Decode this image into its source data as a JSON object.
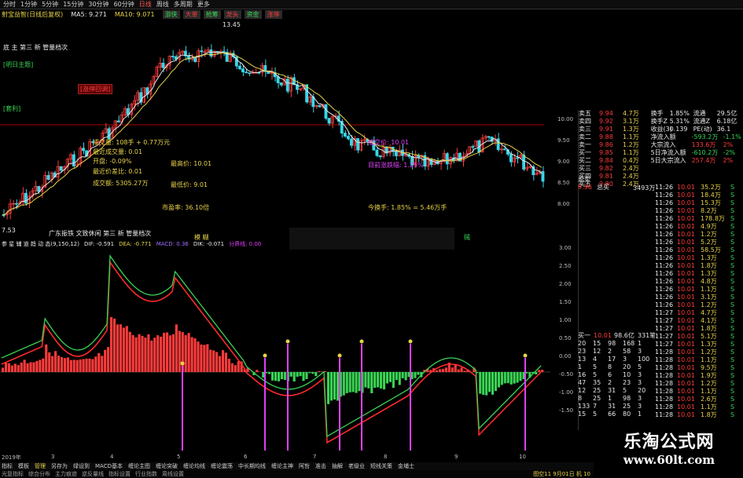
{
  "topbar": {
    "items": [
      "分时",
      "1分钟",
      "5分钟",
      "15分钟",
      "30分钟",
      "60分钟",
      "日线",
      "周线",
      "多周期",
      "更多"
    ],
    "selected": "日线"
  },
  "infobar": {
    "title": "射宝益智(日线后复权)",
    "ma_label": "MA5: 9.271",
    "ma10_label": "MA10: 9.071",
    "chips": [
      "游侠",
      "大单",
      "抢筹",
      "龙头",
      "资金",
      "涨停"
    ]
  },
  "main_chart": {
    "price_high_label": "13.45",
    "price_low_label": "7.53",
    "top_left_text": "底 主  第三 新 管量档次",
    "indicator_tag_1": "[明日主题]",
    "indicator_tag_2": "[套利]",
    "indicator_tag_3": "[涨停回调]",
    "box_labels": [
      "成交量: 108手 + 0.77万元",
      "最近成交量: 0.01",
      "开盘: -0.09%",
      "最近价差比: 0.01",
      "成交额: 5305.27万",
      "最高价: 10.01",
      "最低价: 9.01",
      "市盈率: 36.10倍"
    ],
    "mid_labels": [
      "成交价: 10.01",
      "目前涨跌幅: 1.25%"
    ],
    "right_label": "今换手: 1.85% = 5.46万手",
    "bottom_text": "广东振铁 文致休闲 第三 新 管量档次",
    "legend_center": "模 糊",
    "legend_right": "贼",
    "yticks": [
      "10.00",
      "9.50",
      "9.00",
      "8.50",
      "8.00"
    ]
  },
  "indicator": {
    "header": "参 星 辅 道 趋 动 态(9,150,12)",
    "dif": "DIF: -0.591",
    "dea": "DEA: -0.771",
    "macd": "MACD: 0.36",
    "dif2": "DIK: -0.071",
    "extra": "分界线: 0.00",
    "yticks": [
      "3.00",
      "2.50",
      "2.00",
      "1.50",
      "1.00",
      "0.50",
      "0.00",
      "-0.50",
      "-1.00",
      "-1.50"
    ],
    "xticks": [
      "2019年",
      "3",
      "4",
      "5",
      "6",
      "7",
      "8",
      "9",
      "10"
    ]
  },
  "right_panel": {
    "sell_rows": [
      {
        "label": "卖五",
        "price": "9.94",
        "vol": "4.7万"
      },
      {
        "label": "卖四",
        "price": "9.92",
        "vol": "3.1万"
      },
      {
        "label": "卖三",
        "price": "9.91",
        "vol": "1.3万"
      },
      {
        "label": "卖二",
        "price": "9.88",
        "vol": "1.1万"
      },
      {
        "label": "卖一",
        "price": "9.86",
        "vol": "1.2万"
      },
      {
        "label": "买一",
        "price": "9.85",
        "vol": "1.1万"
      },
      {
        "label": "买二",
        "price": "9.84",
        "vol": "0.4万"
      },
      {
        "label": "买三",
        "price": "9.82",
        "vol": "2.4万"
      },
      {
        "label": "买四",
        "price": "9.81",
        "vol": "2.4万"
      },
      {
        "label": "买五",
        "price": "9.80",
        "vol": "2.4万"
      }
    ],
    "summary_rows": [
      {
        "a": "换手",
        "b": "1.85%",
        "c": "流通",
        "d": "29.5亿"
      },
      {
        "a": "换手Z",
        "b": "5.31%",
        "c": "流通Z",
        "d": "6.18亿"
      },
      {
        "a": "收益(3)",
        "b": "0.139",
        "c": "PE(动)",
        "d": "36.1"
      }
    ],
    "flow_rows": [
      {
        "label": "净流入额",
        "value": "-593.2万",
        "pct": "-1.1%"
      },
      {
        "label": "大宗流入",
        "value": "133.6万",
        "pct": "2%"
      },
      {
        "label": "5日净流入额",
        "value": "-610.2万",
        "pct": "-2%"
      },
      {
        "label": "5日大宗流入",
        "value": "257.4万",
        "pct": "2%"
      }
    ],
    "totals": {
      "t1": "总卖",
      "t2": "总买",
      "v": "3493万"
    },
    "ticks": [
      {
        "time": "11:26",
        "price": "10.01",
        "vol": "35.2万",
        "side": "S"
      },
      {
        "time": "11:26",
        "price": "10.01",
        "vol": "18.4万",
        "side": "S"
      },
      {
        "time": "11:26",
        "price": "10.01",
        "vol": "15.3万",
        "side": "S"
      },
      {
        "time": "11:26",
        "price": "10.01",
        "vol": "8.2万",
        "side": "S"
      },
      {
        "time": "11:26",
        "price": "10.01",
        "vol": "178.8万",
        "side": "S"
      },
      {
        "time": "11:26",
        "price": "10.01",
        "vol": "4.9万",
        "side": "S"
      },
      {
        "time": "11:26",
        "price": "10.01",
        "vol": "1.2万",
        "side": "S"
      },
      {
        "time": "11:26",
        "price": "10.01",
        "vol": "5.2万",
        "side": "S"
      },
      {
        "time": "11:26",
        "price": "10.01",
        "vol": "58.5万",
        "side": "S"
      },
      {
        "time": "11:26",
        "price": "10.01",
        "vol": "1.3万",
        "side": "S"
      },
      {
        "time": "11:26",
        "price": "10.01",
        "vol": "1.8万",
        "side": "S"
      },
      {
        "time": "11:26",
        "price": "10.01",
        "vol": "1.3万",
        "side": "S"
      },
      {
        "time": "11:26",
        "price": "10.01",
        "vol": "4.8万",
        "side": "S"
      },
      {
        "time": "11:26",
        "price": "10.01",
        "vol": "1.1万",
        "side": "S"
      },
      {
        "time": "11:26",
        "price": "10.01",
        "vol": "3.1万",
        "side": "S"
      },
      {
        "time": "11:26",
        "price": "10.01",
        "vol": "1.2万",
        "side": "S"
      },
      {
        "time": "11:27",
        "price": "10.01",
        "vol": "4.7万",
        "side": "S"
      },
      {
        "time": "11:27",
        "price": "10.01",
        "vol": "4.1万",
        "side": "S"
      },
      {
        "time": "11:27",
        "price": "10.01",
        "vol": "1.8万",
        "side": "S"
      },
      {
        "time": "11:27",
        "price": "10.01",
        "vol": "5.1万",
        "side": "S"
      },
      {
        "time": "11:27",
        "price": "10.01",
        "vol": "1.3万",
        "side": "S"
      },
      {
        "time": "11:28",
        "price": "10.01",
        "vol": "1.2万",
        "side": "S"
      },
      {
        "time": "11:28",
        "price": "10.01",
        "vol": "1.1万",
        "side": "S"
      },
      {
        "time": "11:28",
        "price": "10.01",
        "vol": "9.5万",
        "side": "S"
      },
      {
        "time": "11:28",
        "price": "10.01",
        "vol": "1.9万",
        "side": "S"
      },
      {
        "time": "11:28",
        "price": "10.01",
        "vol": "1.2万",
        "side": "S"
      },
      {
        "time": "11:28",
        "price": "10.01",
        "vol": "1.1万",
        "side": "S"
      },
      {
        "time": "11:28",
        "price": "10.01",
        "vol": "2.6万",
        "side": "S"
      },
      {
        "time": "11:28",
        "price": "10.01",
        "vol": "1.1万",
        "side": "S"
      },
      {
        "time": "11:28",
        "price": "10.01",
        "vol": "1.8万",
        "side": "S"
      }
    ],
    "queue_header": {
      "label": "买一",
      "price": "10.01",
      "vol": "98.6亿",
      "count": "331笔"
    },
    "queue_rows": [
      [
        "20",
        "15",
        "98",
        "168",
        "1"
      ],
      [
        "23",
        "12",
        "2",
        "58",
        "3"
      ],
      [
        "13",
        "4",
        "17",
        "3",
        "100"
      ],
      [
        "1",
        "5",
        "8",
        "20",
        "5"
      ],
      [
        "16",
        "5",
        "6",
        "10",
        "3"
      ],
      [
        "47",
        "35",
        "2",
        "23",
        "3"
      ],
      [
        "12",
        "25",
        "31",
        "5",
        "20"
      ],
      [
        "8",
        "25",
        "1",
        "98",
        "3"
      ],
      [
        "133",
        "7",
        "31",
        "25",
        "3"
      ],
      [
        "15",
        "5",
        "66",
        "80",
        "1"
      ]
    ]
  },
  "bottombar": {
    "items": [
      "指标",
      "模板",
      "管理",
      "另存为",
      "绿设到",
      "MACD基本",
      "缠论主图",
      "缠论突破",
      "缠论均线",
      "缠论震荡",
      "中长期均线",
      "缠论主神",
      "阿哲",
      "准击",
      "抽解",
      "老级业",
      "短线关策",
      "金埔士"
    ],
    "selected": "管理"
  },
  "statusbar": {
    "items": [
      "光复指标",
      "综合分布",
      "主力痕迹",
      "逆反量线",
      "指标设置",
      "行业指数",
      "周线设置"
    ],
    "date_info": "图空11 9月01日 机 10"
  },
  "watermark": {
    "brand": "乐淘公式网",
    "url": "www.60lt.com"
  },
  "colors": {
    "up": "#ff3b3b",
    "down": "#39d353",
    "accent": "#e8d24a",
    "bar_cyan": "#38d6e8"
  }
}
